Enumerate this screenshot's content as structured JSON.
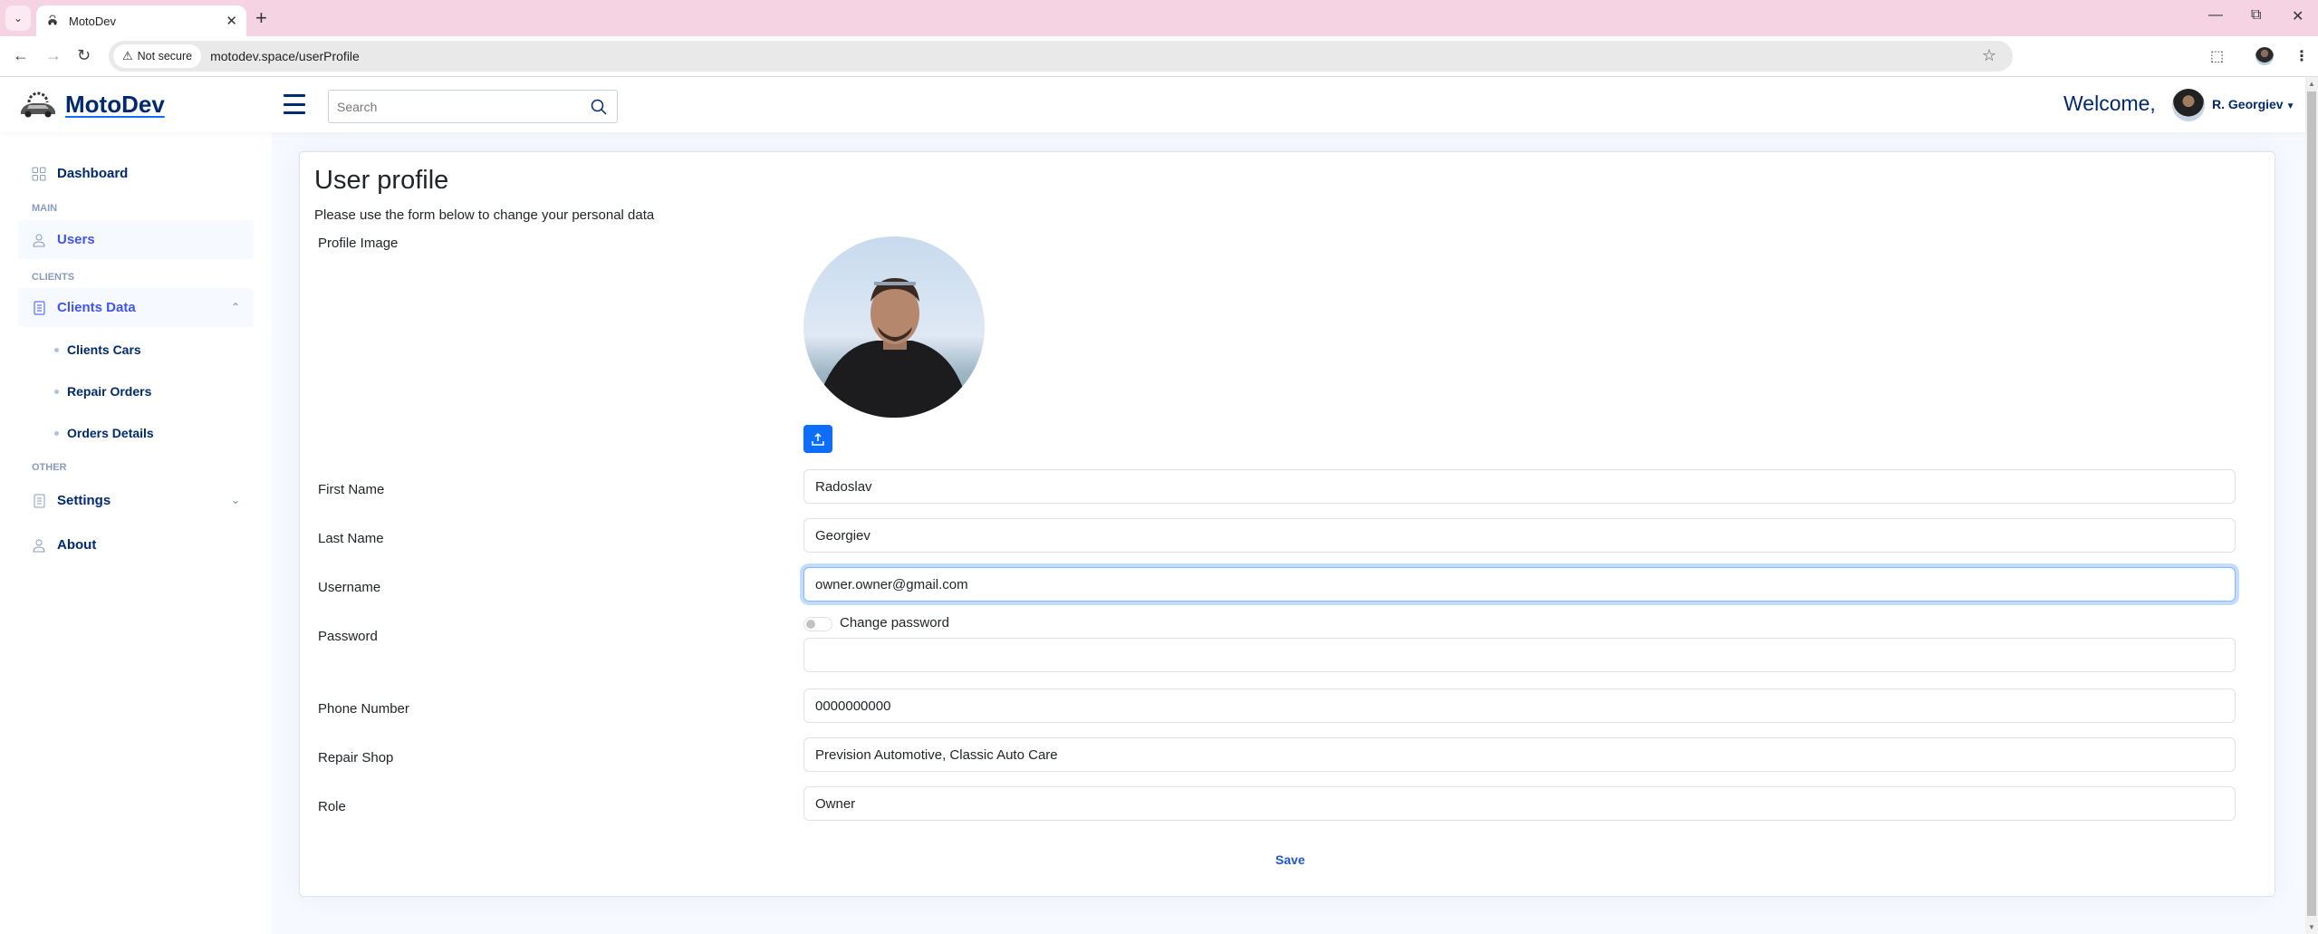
{
  "browser": {
    "tab_title": "MotoDev",
    "security_label": "Not secure",
    "url": "motodev.space/userProfile"
  },
  "header": {
    "logo_text": "MotoDev",
    "search_placeholder": "Search",
    "welcome_text": "Welcome,",
    "user_name": "R. Georgiev"
  },
  "sidebar": {
    "dashboard": "Dashboard",
    "sections": {
      "main": "MAIN",
      "clients": "CLIENTS",
      "other": "OTHER"
    },
    "users": "Users",
    "clients_data": "Clients Data",
    "clients_sub": [
      "Clients Cars",
      "Repair Orders",
      "Orders Details"
    ],
    "settings": "Settings",
    "about": "About"
  },
  "profile": {
    "title": "User profile",
    "subtitle": "Please use the form below to change your personal data",
    "profile_image_label": "Profile Image",
    "fields": {
      "first_name": {
        "label": "First Name",
        "value": "Radoslav"
      },
      "last_name": {
        "label": "Last Name",
        "value": "Georgiev"
      },
      "username": {
        "label": "Username",
        "value": "owner.owner@gmail.com"
      },
      "password": {
        "label": "Password",
        "toggle_label": "Change password",
        "toggle_on": false,
        "value": ""
      },
      "phone": {
        "label": "Phone Number",
        "value": "0000000000"
      },
      "repair_shop": {
        "label": "Repair Shop",
        "value": "Prevision Automotive, Classic Auto Care"
      },
      "role": {
        "label": "Role",
        "value": "Owner"
      }
    },
    "save_label": "Save"
  },
  "colors": {
    "primary": "#0d6efd",
    "nav_text": "#012970",
    "active_nav": "#4154f1",
    "tab_bar": "#f6d3e2"
  }
}
